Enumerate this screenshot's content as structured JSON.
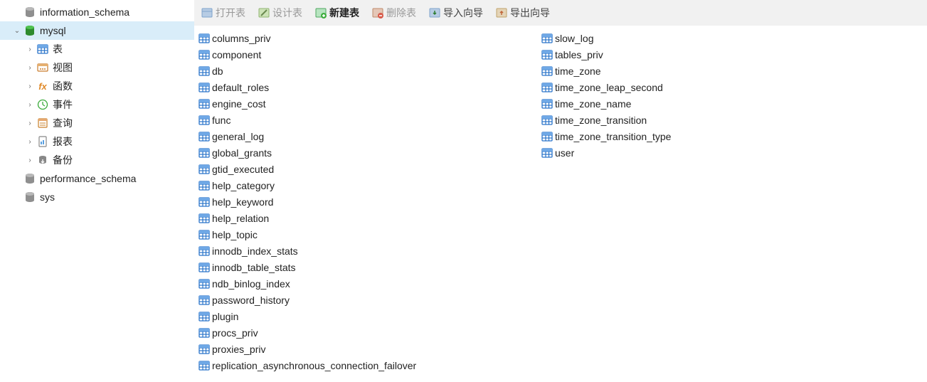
{
  "sidebar": {
    "databases": [
      {
        "name": "information_schema",
        "selected": false,
        "expanded": false,
        "icon": "db-gray"
      },
      {
        "name": "mysql",
        "selected": true,
        "expanded": true,
        "icon": "db-green"
      },
      {
        "name": "performance_schema",
        "selected": false,
        "expanded": false,
        "icon": "db-gray"
      },
      {
        "name": "sys",
        "selected": false,
        "expanded": false,
        "icon": "db-gray"
      }
    ],
    "mysql_children": [
      {
        "label": "表",
        "icon": "table"
      },
      {
        "label": "视图",
        "icon": "view"
      },
      {
        "label": "函数",
        "icon": "fx"
      },
      {
        "label": "事件",
        "icon": "event"
      },
      {
        "label": "查询",
        "icon": "query"
      },
      {
        "label": "报表",
        "icon": "report"
      },
      {
        "label": "备份",
        "icon": "backup"
      }
    ]
  },
  "toolbar": {
    "buttons": [
      {
        "label": "打开表",
        "icon": "open",
        "disabled": true,
        "bold": false
      },
      {
        "label": "设计表",
        "icon": "design",
        "disabled": true,
        "bold": false
      },
      {
        "label": "新建表",
        "icon": "new",
        "disabled": false,
        "bold": true
      },
      {
        "label": "删除表",
        "icon": "delete",
        "disabled": true,
        "bold": false
      },
      {
        "label": "导入向导",
        "icon": "import",
        "disabled": false,
        "bold": false
      },
      {
        "label": "导出向导",
        "icon": "export",
        "disabled": false,
        "bold": false
      }
    ]
  },
  "tables": [
    "columns_priv",
    "component",
    "db",
    "default_roles",
    "engine_cost",
    "func",
    "general_log",
    "global_grants",
    "gtid_executed",
    "help_category",
    "help_keyword",
    "help_relation",
    "help_topic",
    "innodb_index_stats",
    "innodb_table_stats",
    "ndb_binlog_index",
    "password_history",
    "plugin",
    "procs_priv",
    "proxies_priv",
    "replication_asynchronous_connection_failover",
    "slow_log",
    "tables_priv",
    "time_zone",
    "time_zone_leap_second",
    "time_zone_name",
    "time_zone_transition",
    "time_zone_transition_type",
    "user"
  ]
}
